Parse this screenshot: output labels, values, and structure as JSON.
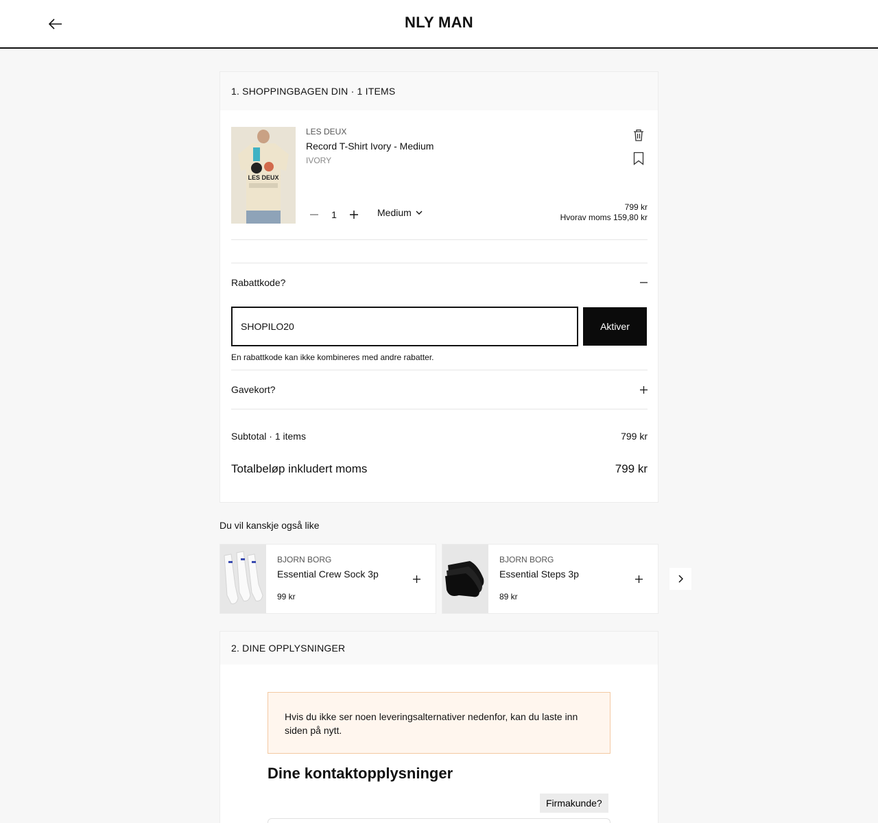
{
  "header": {
    "brand": "NLY MAN"
  },
  "bag": {
    "title": "1. SHOPPINGBAGEN DIN · 1 ITEMS",
    "item": {
      "brand": "LES DEUX",
      "name": "Record T-Shirt Ivory - Medium",
      "color": "IVORY",
      "quantity": "1",
      "size": "Medium",
      "price": "799 kr",
      "vat": "Hvorav moms 159,80 kr",
      "graphic_text": "LES DEUX"
    },
    "discount": {
      "label": "Rabattkode?",
      "value": "SHOPILO20",
      "button": "Aktiver",
      "note": "En rabattkode kan ikke kombineres med andre rabatter."
    },
    "giftcard": {
      "label": "Gavekort?"
    },
    "subtotal": {
      "label": "Subtotal · 1 items",
      "value": "799 kr"
    },
    "total": {
      "label": "Totalbeløp inkludert moms",
      "value": "799 kr"
    }
  },
  "recommendations": {
    "title": "Du vil kanskje også like",
    "items": [
      {
        "brand": "BJORN BORG",
        "name": "Essential Crew Sock 3p",
        "price": "99 kr"
      },
      {
        "brand": "BJORN BORG",
        "name": "Essential Steps 3p",
        "price": "89 kr"
      }
    ]
  },
  "details": {
    "title": "2. DINE OPPLYSNINGER",
    "notice": "Hvis du ikke ser noen leveringsalternativer nedenfor, kan du laste inn siden på nytt.",
    "contact_title": "Dine kontaktopplysninger",
    "business_button": "Firmakunde?"
  },
  "colors": {
    "accent": "#0b0b0b",
    "notice_bg": "#fff6ee",
    "notice_border": "#f3c9a2",
    "page_bg": "#f7f7f7"
  }
}
